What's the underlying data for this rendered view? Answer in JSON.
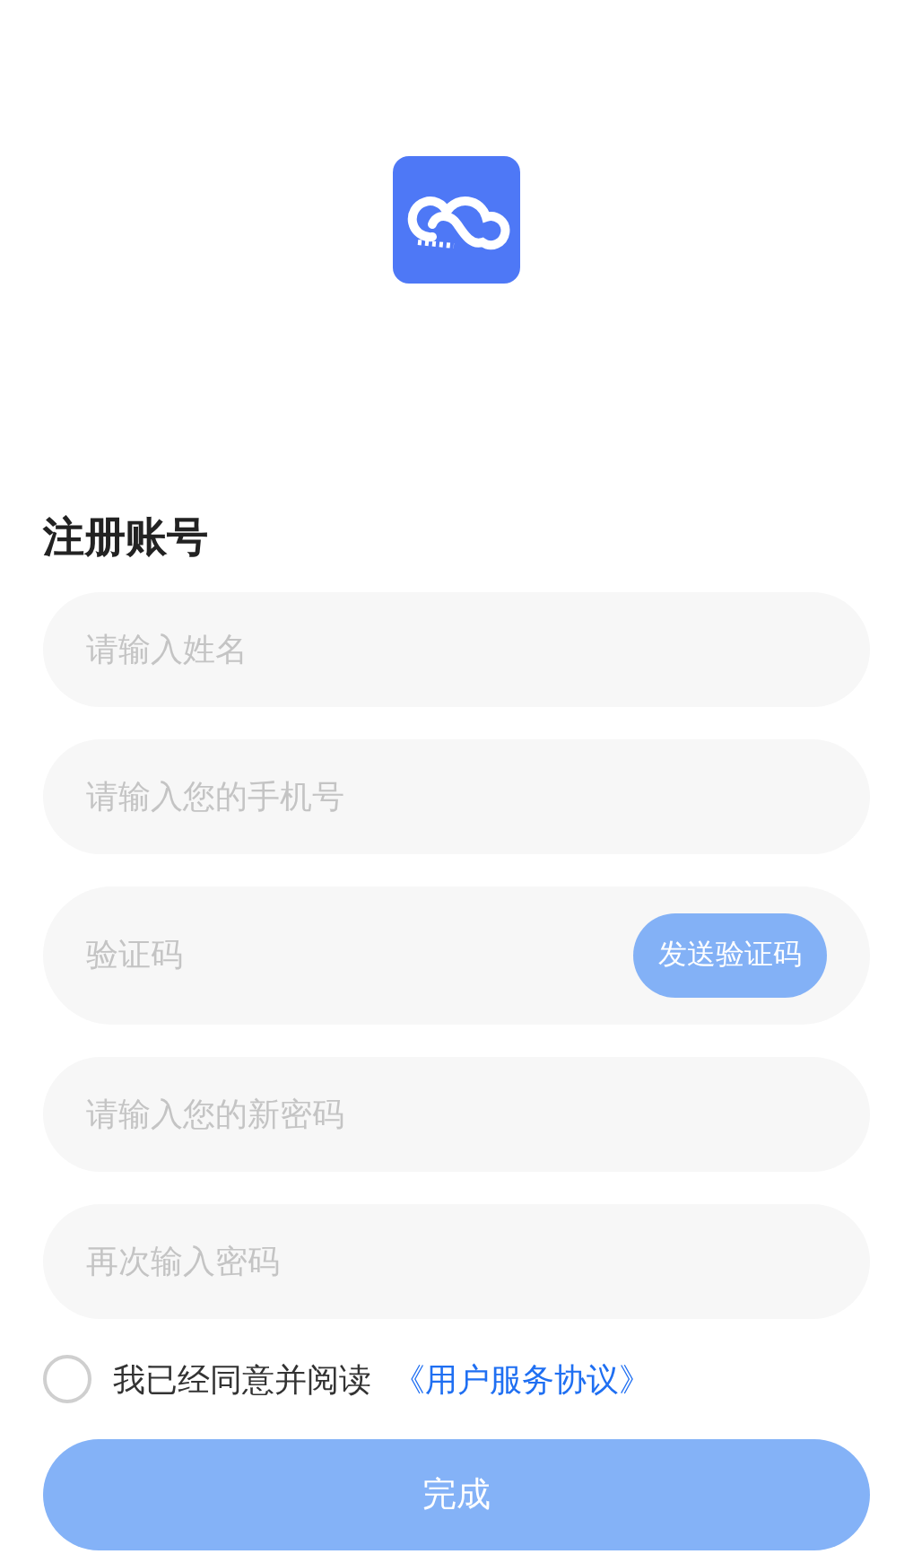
{
  "title": "注册账号",
  "fields": [
    {
      "kind": "text",
      "placeholder": "请输入姓名"
    },
    {
      "kind": "text",
      "placeholder": "请输入您的手机号"
    },
    {
      "kind": "code",
      "placeholder": "验证码",
      "button": "发送验证码"
    },
    {
      "kind": "text",
      "placeholder": "请输入您的新密码"
    },
    {
      "kind": "text",
      "placeholder": "再次输入密码"
    }
  ],
  "agreement": {
    "checked": false,
    "text": "我已经同意并阅读",
    "link": "《用户服务协议》"
  },
  "submit": "完成"
}
